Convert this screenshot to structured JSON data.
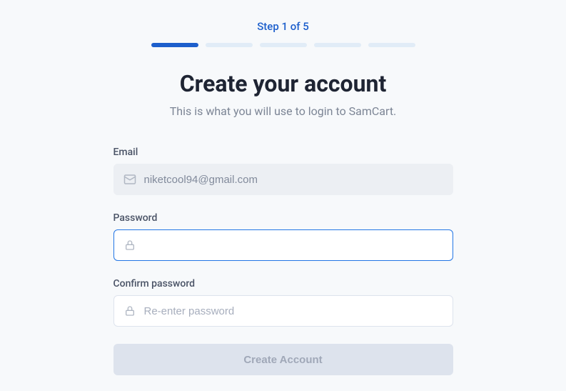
{
  "step": {
    "label": "Step 1 of 5",
    "current": 1,
    "total": 5
  },
  "header": {
    "title": "Create your account",
    "subtitle": "This is what you will use to login to SamCart."
  },
  "form": {
    "email": {
      "label": "Email",
      "value": "niketcool94@gmail.com",
      "icon": "mail-icon"
    },
    "password": {
      "label": "Password",
      "value": "",
      "placeholder": "",
      "icon": "lock-icon"
    },
    "confirm_password": {
      "label": "Confirm password",
      "value": "",
      "placeholder": "Re-enter password",
      "icon": "lock-icon"
    },
    "submit_label": "Create Account"
  },
  "colors": {
    "primary": "#1d5fcc",
    "progress_inactive": "#e1ecf7",
    "title": "#1e2433",
    "subtitle": "#7c8595",
    "input_border": "#dde3ed",
    "input_focus": "#2376e5",
    "button_disabled_bg": "#dde3ed",
    "button_disabled_text": "#a0a8b8"
  }
}
